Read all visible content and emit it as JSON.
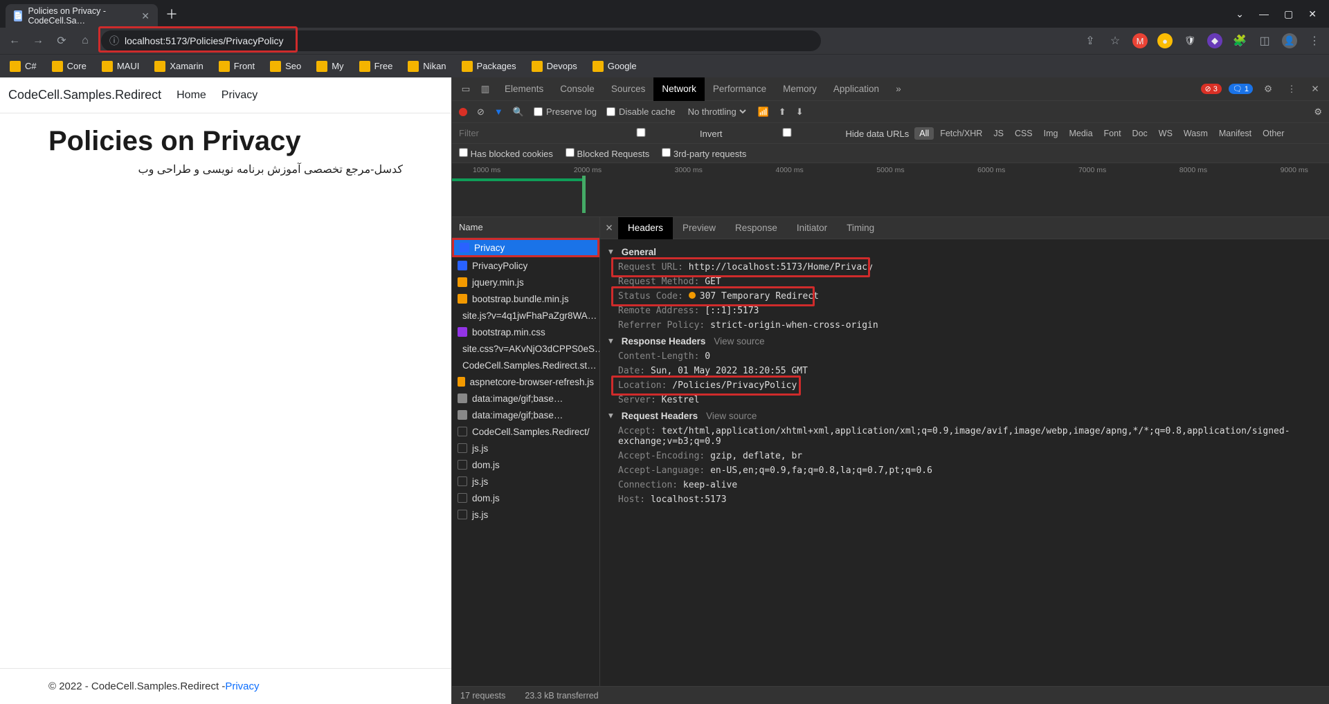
{
  "browser": {
    "tab_title": "Policies on Privacy - CodeCell.Sa…",
    "url": "localhost:5173/Policies/PrivacyPolicy",
    "bookmarks": [
      "C#",
      "Core",
      "MAUI",
      "Xamarin",
      "Front",
      "Seo",
      "My",
      "Free",
      "Nikan",
      "Packages",
      "Devops",
      "Google"
    ]
  },
  "page": {
    "brand": "CodeCell.Samples.Redirect",
    "nav": [
      "Home",
      "Privacy"
    ],
    "h1": "Policies on Privacy",
    "body_fa": "کدسل-مرجع تخصصی آموزش برنامه نویسی و طراحی وب",
    "footer_pre": "© 2022 - CodeCell.Samples.Redirect - ",
    "footer_link": "Privacy"
  },
  "devtools": {
    "panels": [
      "Elements",
      "Console",
      "Sources",
      "Network",
      "Performance",
      "Memory",
      "Application"
    ],
    "active_panel": "Network",
    "errors": "3",
    "infos": "1",
    "toolbar": {
      "preserve": "Preserve log",
      "disable": "Disable cache",
      "throttle": "No throttling"
    },
    "filter_placeholder": "Filter",
    "invert": "Invert",
    "hide": "Hide data URLs",
    "types": [
      "All",
      "Fetch/XHR",
      "JS",
      "CSS",
      "Img",
      "Media",
      "Font",
      "Doc",
      "WS",
      "Wasm",
      "Manifest",
      "Other"
    ],
    "row2": [
      "Has blocked cookies",
      "Blocked Requests",
      "3rd-party requests"
    ],
    "timeline_ticks": [
      "1000 ms",
      "2000 ms",
      "3000 ms",
      "4000 ms",
      "5000 ms",
      "6000 ms",
      "7000 ms",
      "8000 ms",
      "9000 ms"
    ],
    "name_hdr": "Name",
    "requests": [
      {
        "n": "Privacy",
        "t": "doc",
        "sel": true,
        "hi": true
      },
      {
        "n": "PrivacyPolicy",
        "t": "doc"
      },
      {
        "n": "jquery.min.js",
        "t": "js"
      },
      {
        "n": "bootstrap.bundle.min.js",
        "t": "js"
      },
      {
        "n": "site.js?v=4q1jwFhaPaZgr8WA…",
        "t": "js"
      },
      {
        "n": "bootstrap.min.css",
        "t": "css"
      },
      {
        "n": "site.css?v=AKvNjO3dCPPS0eS…",
        "t": "css"
      },
      {
        "n": "CodeCell.Samples.Redirect.st…",
        "t": "css"
      },
      {
        "n": "aspnetcore-browser-refresh.js",
        "t": "js"
      },
      {
        "n": "data:image/gif;base…",
        "t": "img"
      },
      {
        "n": "data:image/gif;base…",
        "t": "img"
      },
      {
        "n": "CodeCell.Samples.Redirect/",
        "t": "other"
      },
      {
        "n": "js.js",
        "t": "other"
      },
      {
        "n": "dom.js",
        "t": "other"
      },
      {
        "n": "js.js",
        "t": "other"
      },
      {
        "n": "dom.js",
        "t": "other"
      },
      {
        "n": "js.js",
        "t": "other"
      }
    ],
    "detail_tabs": [
      "Headers",
      "Preview",
      "Response",
      "Initiator",
      "Timing"
    ],
    "sections": {
      "general": "General",
      "response": "Response Headers",
      "request": "Request Headers",
      "view_source": "View source"
    },
    "general": [
      {
        "k": "Request URL:",
        "v": "http://localhost:5173/Home/Privacy",
        "hi": "hl1"
      },
      {
        "k": "Request Method:",
        "v": "GET"
      },
      {
        "k": "Status Code:",
        "v": "307 Temporary Redirect",
        "dot": true,
        "hi": "hl2"
      },
      {
        "k": "Remote Address:",
        "v": "[::1]:5173"
      },
      {
        "k": "Referrer Policy:",
        "v": "strict-origin-when-cross-origin"
      }
    ],
    "resp": [
      {
        "k": "Content-Length:",
        "v": "0"
      },
      {
        "k": "Date:",
        "v": "Sun, 01 May 2022 18:20:55 GMT"
      },
      {
        "k": "Location:",
        "v": "/Policies/PrivacyPolicy",
        "hi": "hl3"
      },
      {
        "k": "Server:",
        "v": "Kestrel"
      }
    ],
    "req": [
      {
        "k": "Accept:",
        "v": "text/html,application/xhtml+xml,application/xml;q=0.9,image/avif,image/webp,image/apng,*/*;q=0.8,application/signed-exchange;v=b3;q=0.9"
      },
      {
        "k": "Accept-Encoding:",
        "v": "gzip, deflate, br"
      },
      {
        "k": "Accept-Language:",
        "v": "en-US,en;q=0.9,fa;q=0.8,la;q=0.7,pt;q=0.6"
      },
      {
        "k": "Connection:",
        "v": "keep-alive"
      },
      {
        "k": "Host:",
        "v": "localhost:5173"
      }
    ],
    "status": {
      "reqs": "17 requests",
      "size": "23.3 kB transferred"
    }
  }
}
